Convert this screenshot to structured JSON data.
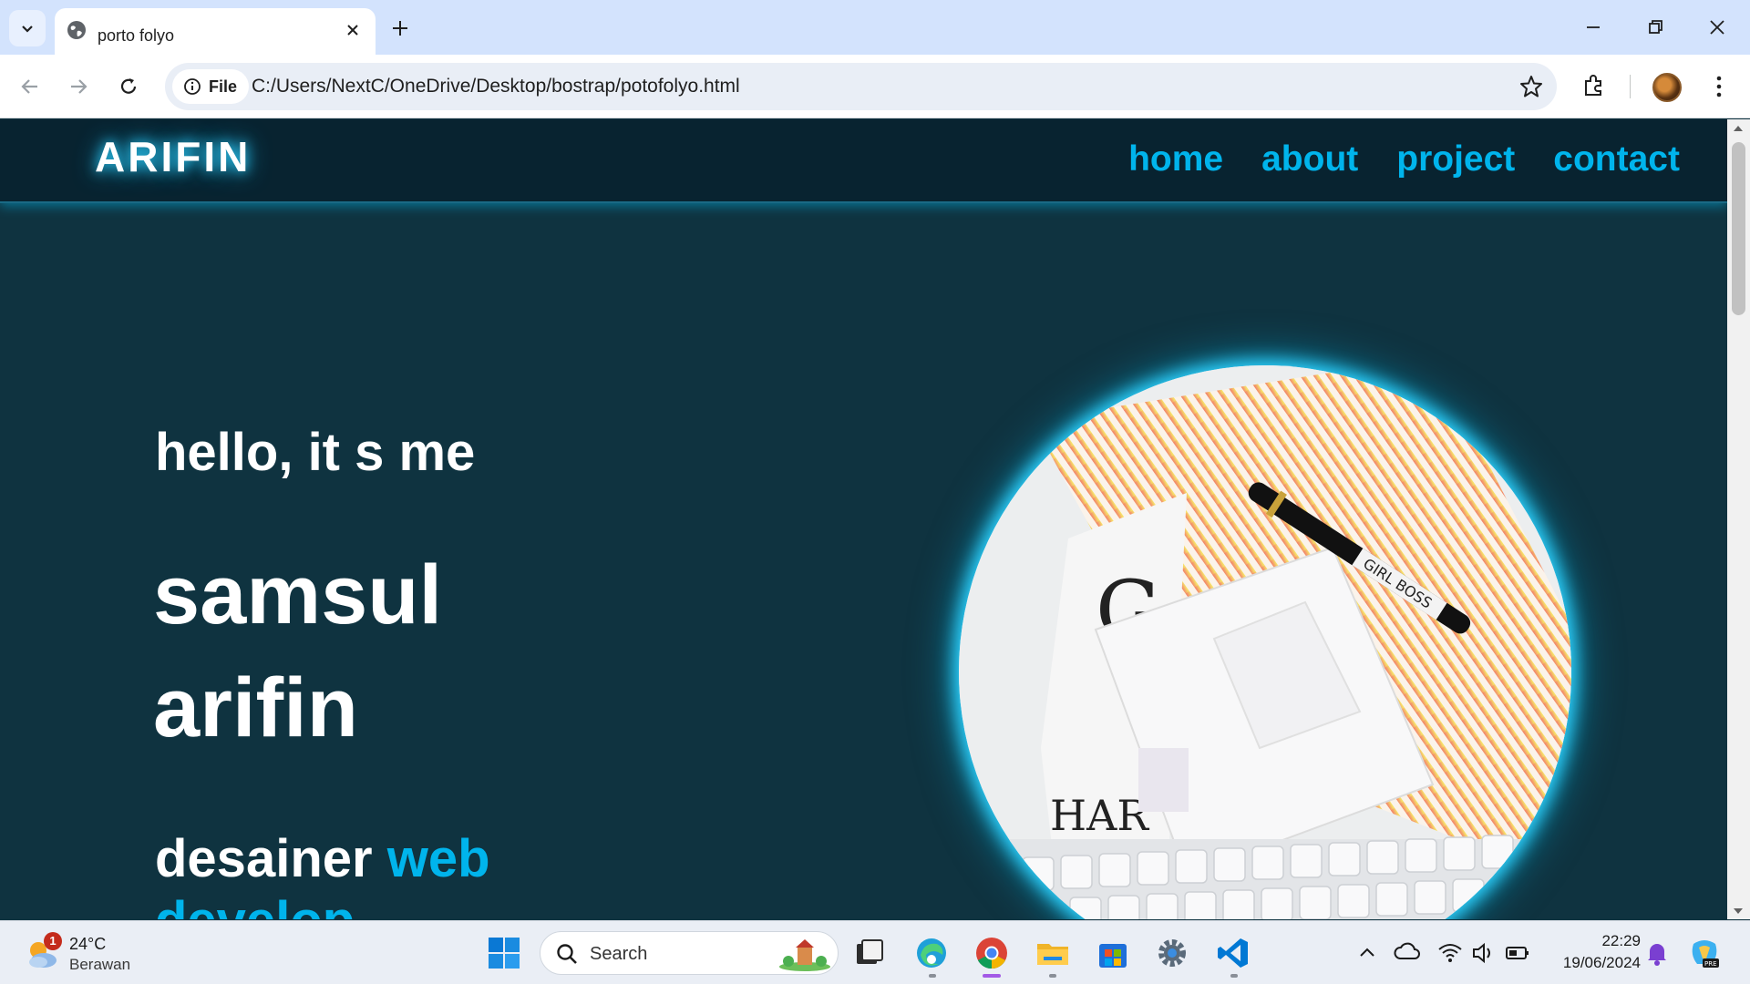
{
  "browser": {
    "tab_title": "porto folyo",
    "site_chip": "File",
    "url": "C:/Users/NextC/OneDrive/Desktop/bostrap/potofolyo.html"
  },
  "site": {
    "logo": "ARIFIN",
    "nav": [
      "home",
      "about",
      "project",
      "contact"
    ],
    "greeting": "hello, it s me",
    "name_line1": "samsul",
    "name_line2": "arifin",
    "role_prefix": "desainer",
    "role_accent": "web develop",
    "accent_color": "#00b4ec",
    "background_color": "#0f3340"
  },
  "taskbar": {
    "weather_badge": "1",
    "temperature": "24°C",
    "condition": "Berawan",
    "search_label": "Search",
    "time": "22:29",
    "date": "19/06/2024"
  }
}
